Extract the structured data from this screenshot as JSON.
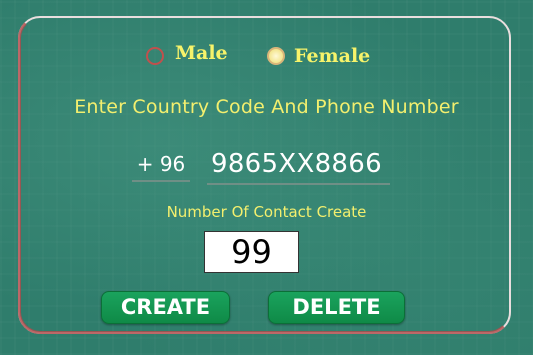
{
  "gender": {
    "options": [
      {
        "label": "Male",
        "selected": false
      },
      {
        "label": "Female",
        "selected": true
      }
    ]
  },
  "form": {
    "heading": "Enter Country Code And Phone Number",
    "country_code": "+ 96",
    "phone_number": "9865XX8866",
    "contact_count_label": "Number Of Contact Create",
    "contact_count_value": "99"
  },
  "actions": {
    "create_label": "CREATE",
    "delete_label": "DELETE"
  },
  "colors": {
    "background": "#2f7d6c",
    "label_yellow": "#f3ef6e",
    "button_green": "#1aa35d",
    "frame_accent": "#b14b4b"
  }
}
